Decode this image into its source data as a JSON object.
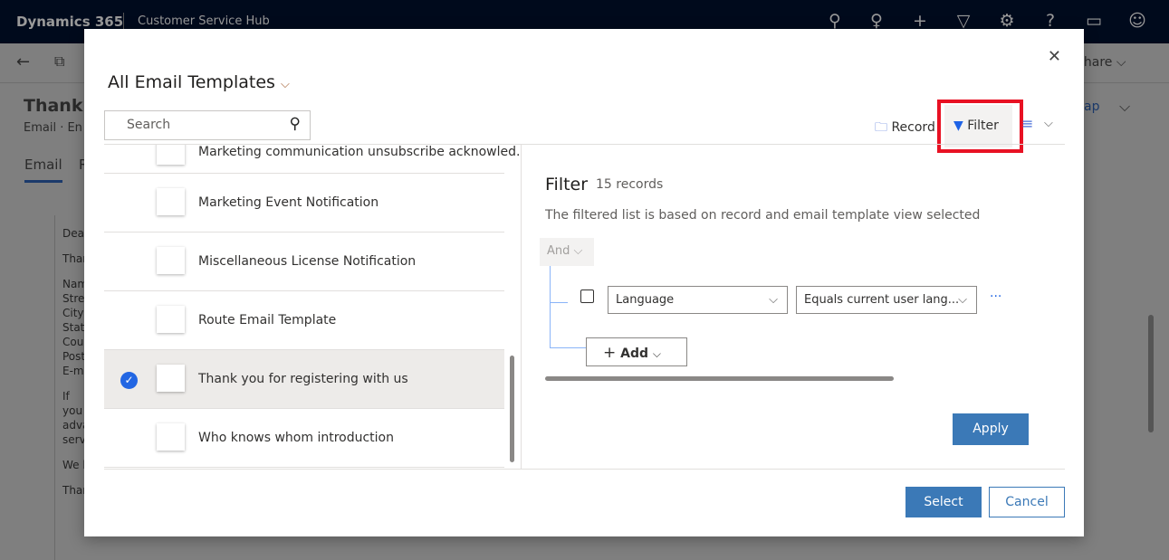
{
  "topbar": {
    "brand": "Dynamics 365",
    "app": "Customer Service Hub",
    "icons": [
      "search-icon",
      "lightbulb-icon",
      "plus-icon",
      "filter-icon",
      "gear-icon",
      "help-icon",
      "chat-icon",
      "smiley-icon"
    ]
  },
  "background": {
    "title": "Thank y",
    "subtitle": "Email · En",
    "tab_email": "Email",
    "tab_other": "R",
    "share": "Share",
    "link": "ap",
    "body_lines": [
      "Dear",
      "Than",
      "Nam",
      "Stree",
      "City:",
      "State",
      "Cour",
      "Posta",
      "E-ma",
      "If you",
      "adva",
      "servi",
      "We l",
      "Than"
    ]
  },
  "dialog": {
    "title": "All Email Templates",
    "search_placeholder": "Search",
    "toolbar": {
      "record": "Record",
      "filter": "Filter"
    },
    "templates": [
      {
        "label": "Marketing communication unsubscribe acknowled...",
        "selected": false
      },
      {
        "label": "Marketing Event Notification",
        "selected": false
      },
      {
        "label": "Miscellaneous License Notification",
        "selected": false
      },
      {
        "label": "Route Email Template",
        "selected": false
      },
      {
        "label": "Thank you for registering with us",
        "selected": true
      },
      {
        "label": "Who knows whom introduction",
        "selected": false
      }
    ],
    "filter": {
      "heading": "Filter",
      "count": "15 records",
      "description": "The filtered list is based on record and email template view selected",
      "group_operator": "And",
      "field": "Language",
      "operator": "Equals current user lang...",
      "more": "···",
      "add": "Add",
      "apply": "Apply"
    },
    "select": "Select",
    "cancel": "Cancel"
  },
  "colors": {
    "accent": "#2266e3",
    "primary_button": "#3b79b7",
    "highlight": "#e81123"
  }
}
